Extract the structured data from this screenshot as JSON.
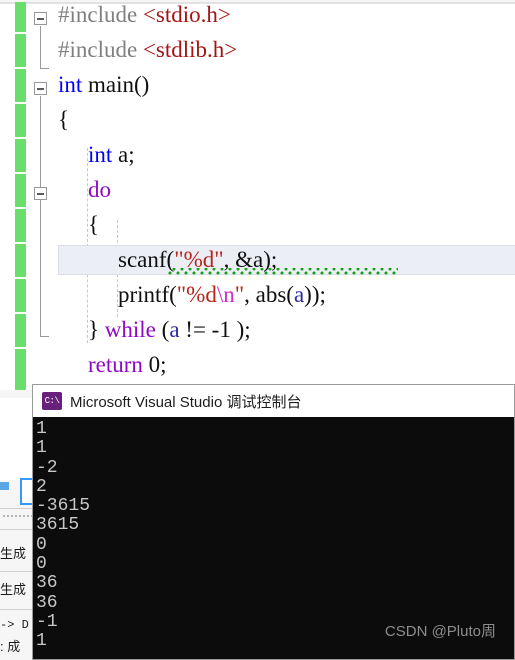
{
  "editor": {
    "lines": [
      {
        "indent": 0,
        "segments": [
          {
            "t": "#include ",
            "c": "pp"
          },
          {
            "t": "<stdio.h>",
            "c": "inc"
          }
        ]
      },
      {
        "indent": 0,
        "segments": [
          {
            "t": "#include ",
            "c": "pp"
          },
          {
            "t": "<stdlib.h>",
            "c": "inc"
          }
        ]
      },
      {
        "indent": 0,
        "segments": [
          {
            "t": "int",
            "c": "kw"
          },
          {
            "t": " main()",
            "c": "id"
          }
        ]
      },
      {
        "indent": 0,
        "segments": [
          {
            "t": "{",
            "c": "punct"
          }
        ]
      },
      {
        "indent": 1,
        "segments": [
          {
            "t": "int",
            "c": "kw"
          },
          {
            "t": " a;",
            "c": "id"
          }
        ]
      },
      {
        "indent": 1,
        "segments": [
          {
            "t": "do",
            "c": "ctl"
          }
        ]
      },
      {
        "indent": 1,
        "segments": [
          {
            "t": "{",
            "c": "punct"
          }
        ]
      },
      {
        "indent": 2,
        "segments": [
          {
            "t": "scanf(",
            "c": "id"
          },
          {
            "t": "\"%d\"",
            "c": "str"
          },
          {
            "t": ", &a);",
            "c": "id"
          }
        ]
      },
      {
        "indent": 2,
        "segments": [
          {
            "t": "printf(",
            "c": "id"
          },
          {
            "t": "\"%d",
            "c": "str"
          },
          {
            "t": "\\n",
            "c": "esc"
          },
          {
            "t": "\"",
            "c": "str"
          },
          {
            "t": ", abs(",
            "c": "id"
          },
          {
            "t": "a",
            "c": "var"
          },
          {
            "t": "));",
            "c": "id"
          }
        ]
      },
      {
        "indent": 1,
        "segments": [
          {
            "t": "} ",
            "c": "punct"
          },
          {
            "t": "while",
            "c": "ctl"
          },
          {
            "t": " (",
            "c": "punct"
          },
          {
            "t": "a",
            "c": "var"
          },
          {
            "t": " != -1 );",
            "c": "punct"
          }
        ]
      },
      {
        "indent": 1,
        "segments": [
          {
            "t": "return",
            "c": "ctl"
          },
          {
            "t": " 0;",
            "c": "punct"
          }
        ]
      }
    ],
    "squiggle_tooltip": "scanf warning squiggle"
  },
  "background_output": {
    "fragments": [
      "生成",
      "生成",
      "-> D",
      ": 成"
    ]
  },
  "console": {
    "title": "Microsoft Visual Studio 调试控制台",
    "icon_label": "C:\\",
    "lines": [
      "1",
      "1",
      "-2",
      "2",
      "-3615",
      "3615",
      "0",
      "0",
      "36",
      "36",
      "-1",
      "1"
    ],
    "watermark": "CSDN @Pluto周"
  },
  "colors": {
    "change_bar_green": "#6ade6a",
    "console_bg": "#0c0c0c",
    "console_fg": "#c7c7c7",
    "keyword_blue": "#0000ff",
    "control_purple": "#8f08c4",
    "string_red": "#b4261c",
    "include_red": "#a31515",
    "preproc_gray": "#808080",
    "escape_magenta": "#cf2fd0",
    "squiggle_green": "#17a017",
    "icon_purple": "#68217a",
    "highlight_band": "#eceef5"
  }
}
